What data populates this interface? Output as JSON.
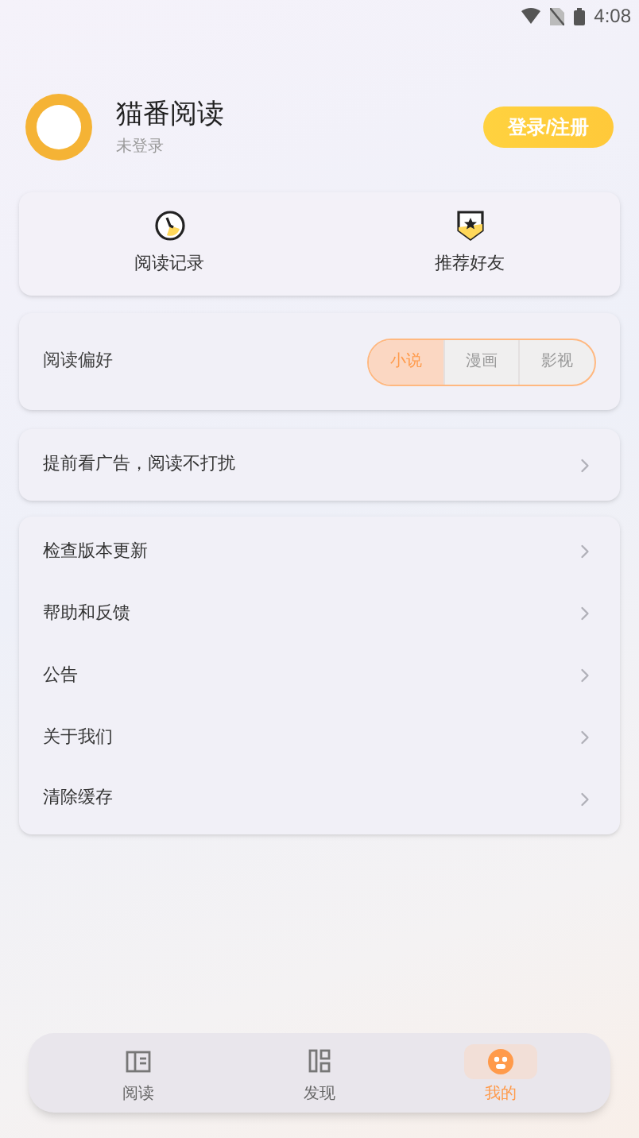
{
  "status_bar": {
    "time": "4:08"
  },
  "profile": {
    "name": "猫番阅读",
    "status": "未登录",
    "login_button": "登录/注册"
  },
  "shortcuts": [
    {
      "kind": "history",
      "label": "阅读记录"
    },
    {
      "kind": "share",
      "label": "推荐好友"
    }
  ],
  "preference": {
    "label": "阅读偏好",
    "options": [
      {
        "label": "小说",
        "selected": true
      },
      {
        "label": "漫画",
        "selected": false
      },
      {
        "label": "影视",
        "selected": false
      }
    ]
  },
  "ad_item": {
    "label": "提前看广告，阅读不打扰"
  },
  "menu": [
    {
      "label": "检查版本更新"
    },
    {
      "label": "帮助和反馈"
    },
    {
      "label": "公告"
    },
    {
      "label": "关于我们"
    },
    {
      "label": "清除缓存"
    }
  ],
  "nav": [
    {
      "kind": "read",
      "label": "阅读",
      "selected": false
    },
    {
      "kind": "discover",
      "label": "发现",
      "selected": false
    },
    {
      "kind": "mine",
      "label": "我的",
      "selected": true
    }
  ]
}
